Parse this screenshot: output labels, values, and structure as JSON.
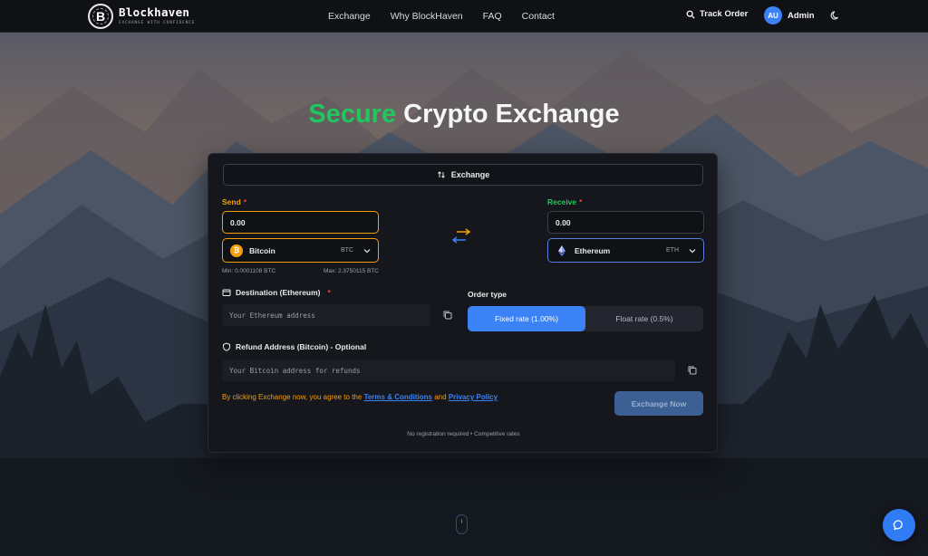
{
  "header": {
    "brand_name": "Blockhaven",
    "brand_tagline": "EXCHANGE WITH CONFIDENCE",
    "brand_initial": "B",
    "nav": [
      {
        "label": "Exchange"
      },
      {
        "label": "Why BlockHaven"
      },
      {
        "label": "FAQ"
      },
      {
        "label": "Contact"
      }
    ],
    "track_order_label": "Track Order",
    "user_initials": "AU",
    "user_name": "Admin"
  },
  "hero": {
    "title_accent": "Secure",
    "title_rest": "Crypto Exchange"
  },
  "card": {
    "tab_label": "Exchange",
    "send": {
      "label": "Send",
      "required_mark": "*",
      "amount": "0.00",
      "coin_name": "Bitcoin",
      "coin_symbol": "BTC",
      "min": "Min: 0.0001108 BTC",
      "max": "Max: 2.3750115 BTC"
    },
    "receive": {
      "label": "Receive",
      "required_mark": "*",
      "amount": "0.00",
      "coin_name": "Ethereum",
      "coin_symbol": "ETH"
    },
    "destination": {
      "label": "Destination (Ethereum)",
      "required_mark": "*",
      "placeholder": "Your Ethereum address"
    },
    "order_type": {
      "label": "Order type",
      "options": [
        {
          "label": "Fixed rate (1.00%)",
          "active": true
        },
        {
          "label": "Float rate (0.5%)",
          "active": false
        }
      ]
    },
    "refund": {
      "label": "Refund Address (Bitcoin) - Optional",
      "placeholder": "Your Bitcoin address for refunds"
    },
    "terms": {
      "prefix": "By clicking Exchange now, you agree to the",
      "terms_link": "Terms & Conditions",
      "and": "and",
      "privacy_link": "Privacy Policy"
    },
    "submit_label": "Exchange Now",
    "footnote": "No registration required • Competitive rates"
  },
  "colors": {
    "accent_green": "#22c55e",
    "accent_orange": "#f59e0b",
    "accent_blue": "#3b82f6"
  },
  "icons": [
    "logo-badge-icon",
    "search-icon",
    "moon-icon",
    "swap-vertical-icon",
    "swap-arrows-icon",
    "bitcoin-icon",
    "ethereum-icon",
    "chevron-down-icon",
    "wallet-icon",
    "shield-icon",
    "copy-icon",
    "chat-icon",
    "scroll-mouse-icon"
  ]
}
